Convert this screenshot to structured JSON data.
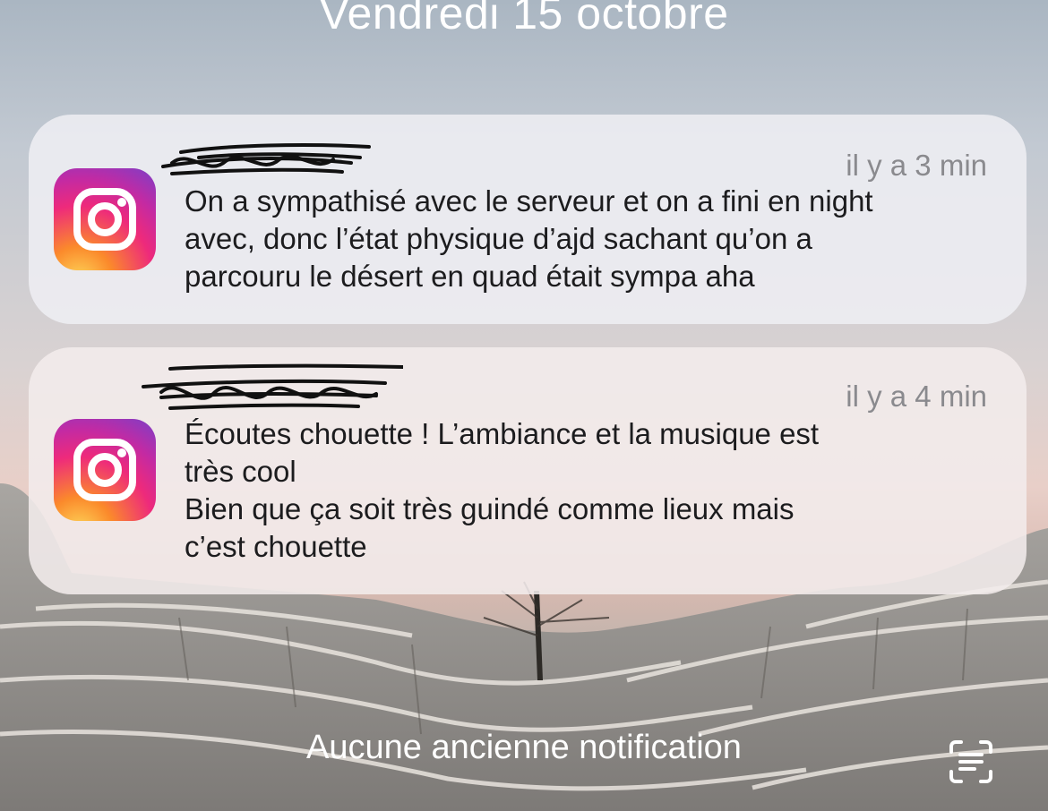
{
  "lockscreen": {
    "date": "Vendredi 15 octobre",
    "footer": "Aucune ancienne notification"
  },
  "notifications": [
    {
      "app_icon": "instagram-icon",
      "sender": "",
      "time": "il y a 3 min",
      "body": "On a sympathisé avec le serveur et on a fini en night\navec, donc l’état physique d’ajd sachant qu’on a\nparcouru le désert en quad était sympa aha"
    },
    {
      "app_icon": "instagram-icon",
      "sender": "",
      "time": "il y a 4 min",
      "body": "Écoutes chouette ! L’ambiance et la musique est\ntrès cool\nBien que ça soit très guindé comme lieux mais\nc’est chouette"
    }
  ],
  "icons": {
    "scan": "text-scan-icon"
  }
}
